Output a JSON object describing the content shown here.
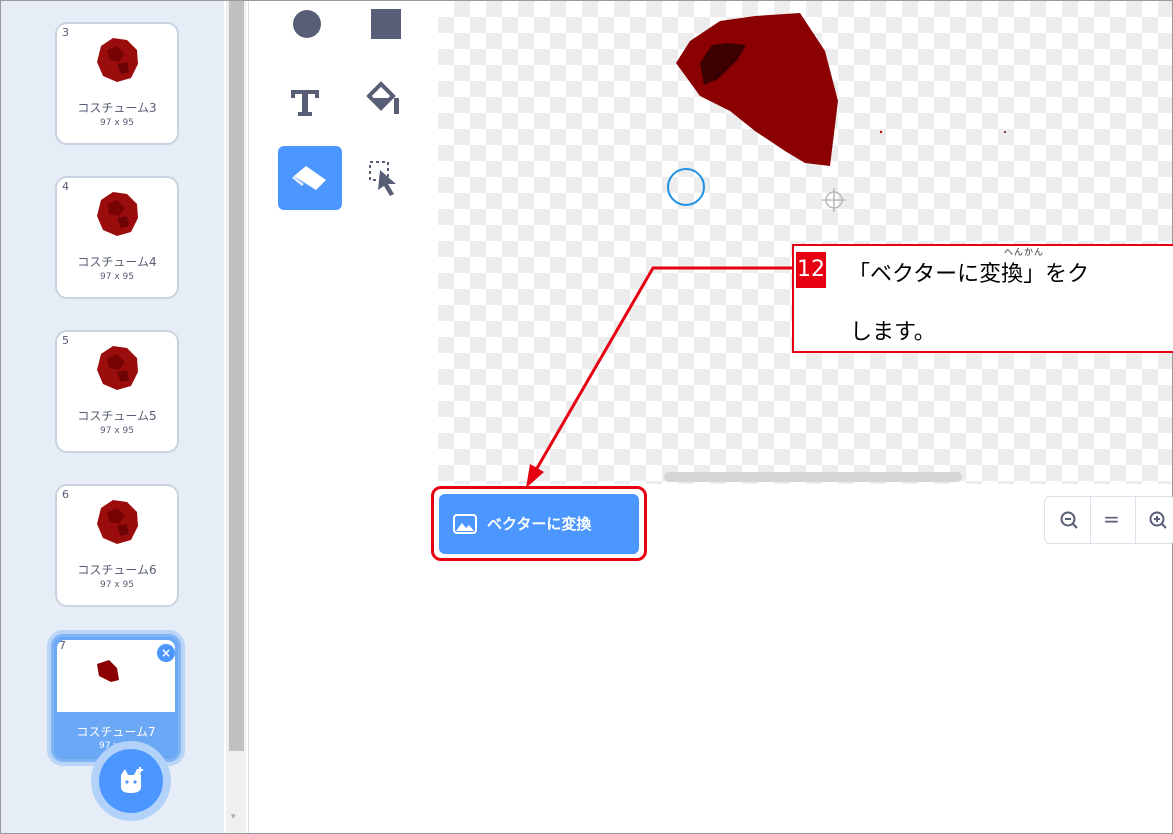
{
  "costumes": [
    {
      "number": "3",
      "name": "コスチューム3",
      "size": "97 x 95"
    },
    {
      "number": "4",
      "name": "コスチューム4",
      "size": "97 x 95"
    },
    {
      "number": "5",
      "name": "コスチューム5",
      "size": "97 x 95"
    },
    {
      "number": "6",
      "name": "コスチューム6",
      "size": "97 x 95"
    },
    {
      "number": "7",
      "name": "コスチューム7",
      "size": "97 x 95"
    }
  ],
  "selected_costume_index": 4,
  "delete_label": "×",
  "convert_button": {
    "label": "ベクターに変換",
    "icon": "image-icon"
  },
  "tools": [
    "circle-tool",
    "rectangle-tool",
    "text-tool",
    "fill-tool",
    "eraser-tool",
    "select-tool"
  ],
  "active_tool": "eraser-tool",
  "zoom_controls": [
    "zoom-out",
    "zoom-reset",
    "zoom-in"
  ],
  "zoom_reset_label": "=",
  "callout": {
    "step": "12",
    "line1": "「ベクターに変換」をク",
    "line2": "します。",
    "ruby": "へんかん"
  },
  "colors": {
    "accent": "#4c97ff",
    "highlight": "#e60012",
    "sprite": "#8b0000"
  }
}
